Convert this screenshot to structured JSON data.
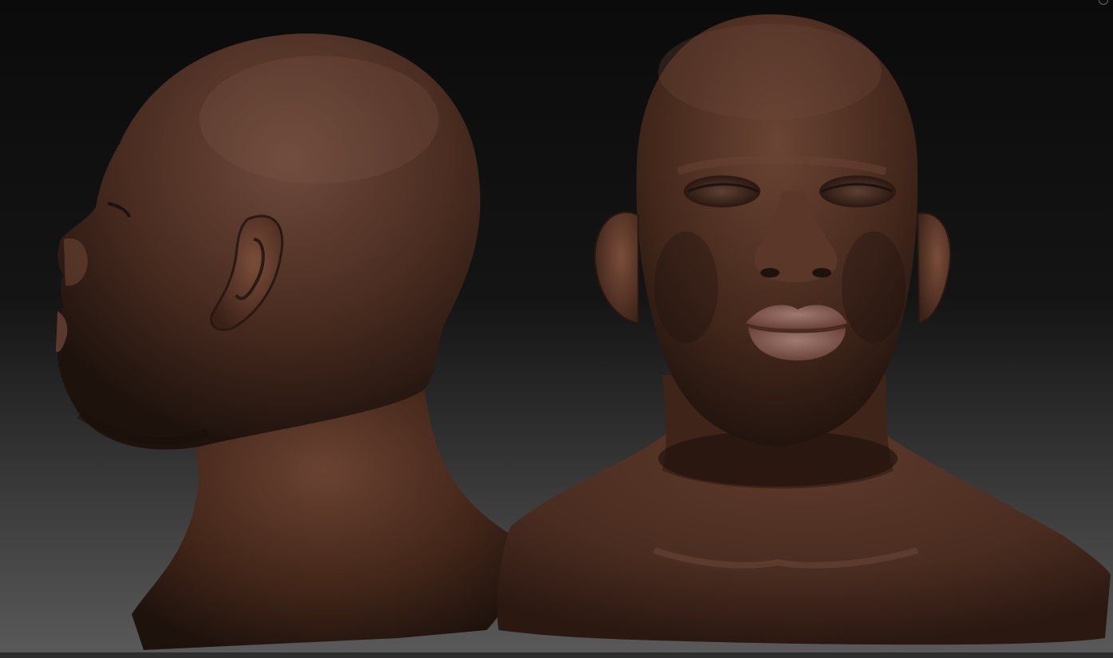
{
  "scene": {
    "background_top": "#0b0b0b",
    "background_bottom": "#5a5a5a",
    "skin_base": "#4a2c20",
    "skin_highlight": "#7a4d3a",
    "skin_shadow": "#1e120d",
    "lip_color": "#8a6058",
    "bottom_strip": "#2e2e2e"
  },
  "views": [
    {
      "id": "side-profile",
      "label": ""
    },
    {
      "id": "front",
      "label": ""
    }
  ]
}
